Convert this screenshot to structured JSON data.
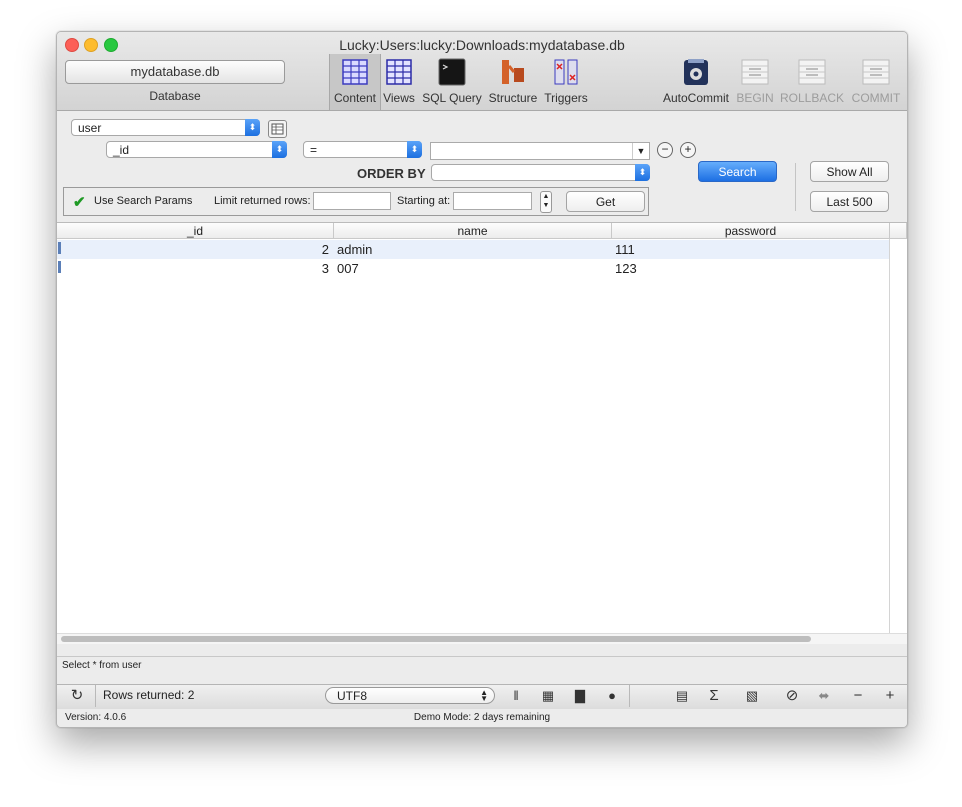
{
  "window": {
    "title": "Lucky:Users:lucky:Downloads:mydatabase.db",
    "traffic_lights": [
      "#fc5f57",
      "#fdbc2e",
      "#28c840"
    ]
  },
  "toolbar": {
    "database_button": "mydatabase.db",
    "database_label": "Database",
    "tools": [
      {
        "label": "Content",
        "icon": "content-table-icon",
        "selected": true
      },
      {
        "label": "Views",
        "icon": "views-table-icon"
      },
      {
        "label": "SQL Query",
        "icon": "terminal-icon"
      },
      {
        "label": "Structure",
        "icon": "structure-icon"
      },
      {
        "label": "Triggers",
        "icon": "triggers-icon"
      },
      {
        "label": "AutoCommit",
        "icon": "autocommit-icon"
      },
      {
        "label": "BEGIN",
        "icon": "begin-icon",
        "disabled": true
      },
      {
        "label": "ROLLBACK",
        "icon": "rollback-icon",
        "disabled": true
      },
      {
        "label": "COMMIT",
        "icon": "commit-icon",
        "disabled": true
      }
    ]
  },
  "filter": {
    "table_select": "user",
    "column_select": "_id",
    "operator_select": "=",
    "value": "",
    "order_by_label": "ORDER BY",
    "order_by_value": "",
    "search_button": "Search",
    "show_all_button": "Show All",
    "last500_button": "Last 500",
    "use_search_params": "Use Search Params",
    "limit_label": "Limit returned rows:",
    "limit_value": "",
    "starting_label": "Starting at:",
    "starting_value": "",
    "get_button": "Get"
  },
  "table": {
    "columns": [
      "_id",
      "name",
      "password"
    ],
    "rows": [
      {
        "_id": "2",
        "name": "admin",
        "password": "111"
      },
      {
        "_id": "3",
        "name": "007",
        "password": "123"
      }
    ]
  },
  "status": {
    "query": "Select * from user",
    "rows_returned": "Rows returned: 2",
    "encoding": "UTF8",
    "version": "Version: 4.0.6",
    "demo": "Demo Mode: 2 days remaining"
  },
  "colors": {
    "accent": "#1f73e6",
    "selected_row": "#e9f0fb"
  }
}
